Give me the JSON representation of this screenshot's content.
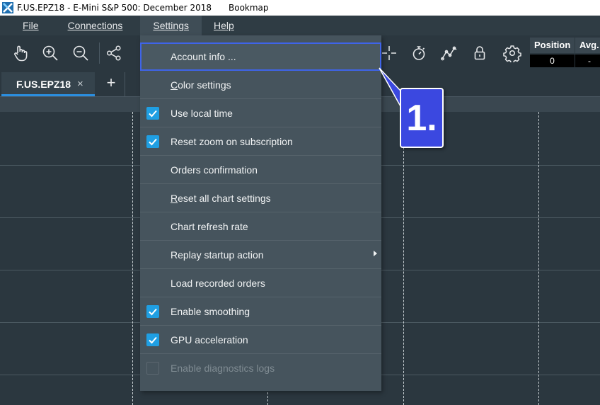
{
  "window": {
    "title": "F.US.EPZ18 - E-Mini S&P 500: December 2018",
    "app_name": "Bookmap",
    "icon": "bookmap-logo-icon"
  },
  "menubar": {
    "file": "File",
    "connections": "Connections",
    "settings": "Settings",
    "help": "Help"
  },
  "toolbar": {
    "icons": [
      "hand-pointer-icon",
      "zoom-in-icon",
      "zoom-out-icon",
      "share-icon",
      "crosshair-icon",
      "stopwatch-icon",
      "indicator-chart-icon",
      "lock-icon",
      "gear-icon"
    ]
  },
  "position_panel": {
    "position_header": "Position",
    "avg_header": "Avg.",
    "position_value": "0",
    "avg_value": "-"
  },
  "tabs": [
    {
      "label": "F.US.EPZ18",
      "close": "×"
    }
  ],
  "tab_add": "+",
  "settings_menu": {
    "items": [
      {
        "label": "Account info ...",
        "checked": null,
        "selected": true
      },
      {
        "label": "Color settings",
        "checked": null
      },
      {
        "label": "Use local time",
        "checked": true
      },
      {
        "label": "Reset zoom on subscription",
        "checked": true
      },
      {
        "label": "Orders confirmation",
        "checked": null
      },
      {
        "label": "Reset all chart settings",
        "checked": null
      },
      {
        "label": "Chart refresh rate",
        "checked": null
      },
      {
        "label": "Replay startup action",
        "checked": null,
        "submenu": true
      },
      {
        "label": "Load recorded orders",
        "checked": null
      },
      {
        "label": "Enable smoothing",
        "checked": true
      },
      {
        "label": "GPU acceleration",
        "checked": true
      },
      {
        "label": "Enable diagnostics logs",
        "checked": false,
        "disabled": true
      }
    ]
  },
  "callout": {
    "label": "1."
  },
  "colors": {
    "accent": "#1f9fe3",
    "callout": "#3b48e0",
    "tab_underline": "#2b8fe0",
    "background": "#2b373f",
    "menu": "#46545d"
  }
}
